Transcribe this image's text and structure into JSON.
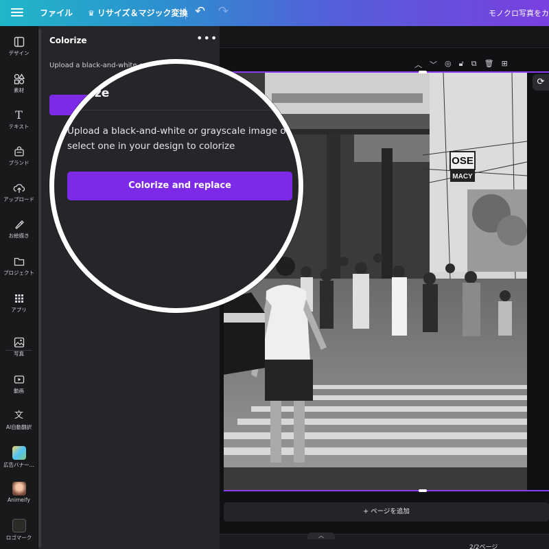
{
  "topbar": {
    "file_label": "ファイル",
    "resize_label": "リサイズ＆マジック変換",
    "title": "モノクロ写真をカラー"
  },
  "rail": {
    "items": [
      {
        "label": "デザイン",
        "icon": "layout-icon"
      },
      {
        "label": "素材",
        "icon": "shapes-icon"
      },
      {
        "label": "テキスト",
        "icon": "text-icon"
      },
      {
        "label": "ブランド",
        "icon": "brand-icon"
      },
      {
        "label": "アップロード",
        "icon": "upload-icon"
      },
      {
        "label": "お絵描き",
        "icon": "draw-icon"
      },
      {
        "label": "プロジェクト",
        "icon": "folder-icon"
      },
      {
        "label": "アプリ",
        "icon": "apps-icon"
      },
      {
        "label": "写真",
        "icon": "photo-icon"
      },
      {
        "label": "動画",
        "icon": "video-icon"
      },
      {
        "label": "AI自動翻訳",
        "icon": "translate-icon"
      },
      {
        "label": "広告バナー…",
        "icon": "ad-banner-app-icon"
      },
      {
        "label": "Animeify",
        "icon": "animeify-app-icon"
      },
      {
        "label": "ロゴマーク",
        "icon": "logo-app-icon"
      }
    ]
  },
  "panel": {
    "title": "Colorize",
    "menu_icon": "more-dots-icon",
    "description": "Upload a black-and-white or select one in yo"
  },
  "magnifier": {
    "title": "ize",
    "description": "Upload a black-and-white or grayscale image or select one in your design to colorize",
    "button_label": "Colorize and replace"
  },
  "canvas": {
    "sign_text_1": "OSE",
    "sign_text_2": "MACY",
    "add_page_label": "+ ページを追加",
    "page_count": "2/2ページ"
  },
  "colors": {
    "accent": "#7d2ae8",
    "topbar_start": "#20b7c9",
    "topbar_end": "#7a3fe0",
    "panel_bg": "#25262a"
  }
}
